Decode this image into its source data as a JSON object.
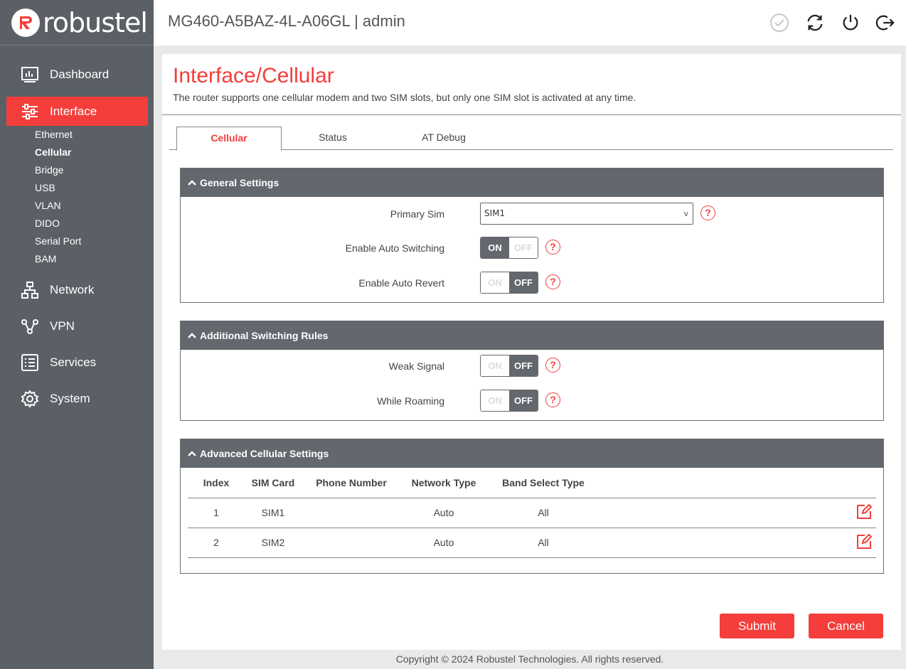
{
  "brand": {
    "name": "robustel",
    "accent": "#f43e3b",
    "sidebar_bg": "#5b5f66"
  },
  "header": {
    "title": "MG460-A5BAZ-4L-A06GL | admin",
    "icons": [
      "check-circle-icon",
      "refresh-icon",
      "power-icon",
      "logout-icon"
    ]
  },
  "sidebar": {
    "items": [
      {
        "label": "Dashboard",
        "icon": "dashboard-icon"
      },
      {
        "label": "Interface",
        "icon": "sliders-icon"
      },
      {
        "label": "Network",
        "icon": "network-icon"
      },
      {
        "label": "VPN",
        "icon": "vpn-icon"
      },
      {
        "label": "Services",
        "icon": "list-icon"
      },
      {
        "label": "System",
        "icon": "gear-icon"
      }
    ],
    "sub_items": [
      "Ethernet",
      "Cellular",
      "Bridge",
      "USB",
      "VLAN",
      "DIDO",
      "Serial Port",
      "BAM"
    ]
  },
  "page": {
    "title": "Interface/Cellular",
    "description": "The router supports one cellular modem and two SIM slots, but only one SIM slot is activated at any time."
  },
  "tabs": [
    "Cellular",
    "Status",
    "AT Debug"
  ],
  "general": {
    "title": "General Settings",
    "primary_sim_label": "Primary Sim",
    "primary_sim_value": "SIM1",
    "auto_switch_label": "Enable Auto Switching",
    "auto_revert_label": "Enable Auto Revert"
  },
  "switching": {
    "title": "Additional Switching Rules",
    "weak_signal_label": "Weak Signal",
    "roaming_label": "While Roaming"
  },
  "toggle": {
    "on": "ON",
    "off": "OFF"
  },
  "help_glyph": "?",
  "advanced": {
    "title": "Advanced Cellular Settings",
    "columns": [
      "Index",
      "SIM Card",
      "Phone Number",
      "Network Type",
      "Band Select Type"
    ],
    "rows": [
      {
        "index": "1",
        "sim": "SIM1",
        "phone": "",
        "network": "Auto",
        "band": "All"
      },
      {
        "index": "2",
        "sim": "SIM2",
        "phone": "",
        "network": "Auto",
        "band": "All"
      }
    ]
  },
  "buttons": {
    "submit": "Submit",
    "cancel": "Cancel"
  },
  "footer": "Copyright © 2024 Robustel Technologies. All rights reserved."
}
